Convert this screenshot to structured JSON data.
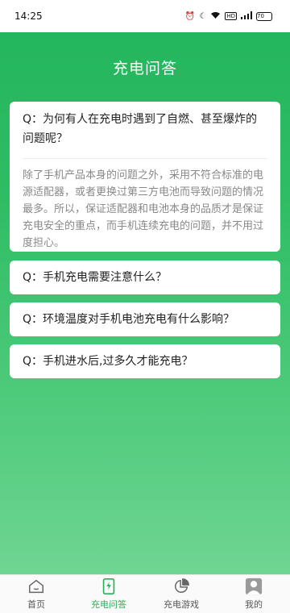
{
  "status_bar": {
    "time": "14:25",
    "battery": "70"
  },
  "header": {
    "title": "充电问答"
  },
  "qa": [
    {
      "question": "Q：为何有人在充电时遇到了自燃、甚至爆炸的问题呢？",
      "answer": "除了手机产品本身的问题之外，采用不符合标准的电源适配器，或者更换过第三方电池而导致问题的情况最多。所以，保证适配器和电池本身的品质才是保证充电安全的重点，而手机连续充电的问题，并不用过度担心。",
      "expanded": true
    },
    {
      "question": "Q：手机充电需要注意什么？",
      "expanded": false
    },
    {
      "question": "Q：环境温度对手机电池充电有什么影响？",
      "expanded": false
    },
    {
      "question": "Q：手机进水后,过多久才能充电？",
      "expanded": false
    }
  ],
  "tabbar": {
    "active_color": "#2ab05a",
    "items": [
      {
        "label": "首页",
        "icon": "home-icon"
      },
      {
        "label": "充电问答",
        "icon": "phone-charge-icon"
      },
      {
        "label": "充电游戏",
        "icon": "pie-chart-icon"
      },
      {
        "label": "我的",
        "icon": "user-icon"
      }
    ]
  }
}
